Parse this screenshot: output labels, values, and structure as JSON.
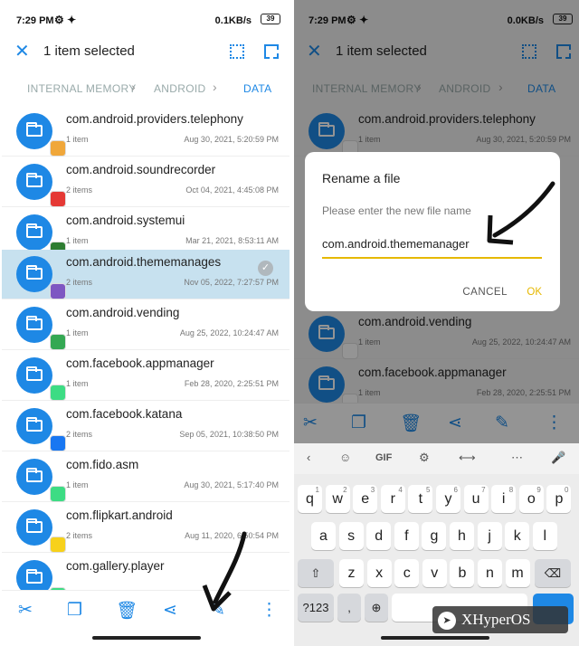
{
  "left": {
    "status": {
      "time": "7:29 PM",
      "net": "0.1KB/s",
      "battery": "39"
    },
    "header": {
      "title": "1 item selected"
    },
    "breadcrumb": [
      "INTERNAL MEMORY",
      "ANDROID",
      "DATA"
    ],
    "rows": [
      {
        "name": "com.android.providers.telephony",
        "count": "1 item",
        "date": "Aug 30, 2021, 5:20:59 PM",
        "badge": "#f0a73a"
      },
      {
        "name": "com.android.soundrecorder",
        "count": "2 items",
        "date": "Oct 04, 2021, 4:45:08 PM",
        "badge": "#e53935"
      },
      {
        "name": "com.android.systemui",
        "count": "1 item",
        "date": "Mar 21, 2021, 8:53:11 AM",
        "badge": "#2e7d32"
      },
      {
        "name": "com.android.thememanages",
        "count": "2 items",
        "date": "Nov 05, 2022, 7:27:57 PM",
        "badge": "#7e57c2"
      },
      {
        "name": "com.android.vending",
        "count": "1 item",
        "date": "Aug 25, 2022, 10:24:47 AM",
        "badge": "#34a853"
      },
      {
        "name": "com.facebook.appmanager",
        "count": "1 item",
        "date": "Feb 28, 2020, 2:25:51 PM",
        "badge": "#3ddc84"
      },
      {
        "name": "com.facebook.katana",
        "count": "2 items",
        "date": "Sep 05, 2021, 10:38:50 PM",
        "badge": "#1877f2"
      },
      {
        "name": "com.fido.asm",
        "count": "1 item",
        "date": "Aug 30, 2021, 5:17:40 PM",
        "badge": "#3ddc84"
      },
      {
        "name": "com.flipkart.android",
        "count": "2 items",
        "date": "Aug 11, 2020, 6:50:54 PM",
        "badge": "#f7d11b"
      },
      {
        "name": "com.gallery.player",
        "count": "",
        "date": "",
        "badge": "#3ddc84"
      }
    ],
    "selected_index": 3
  },
  "right": {
    "status": {
      "time": "7:29 PM",
      "net": "0.0KB/s",
      "battery": "39"
    },
    "header": {
      "title": "1 item selected"
    },
    "breadcrumb": [
      "INTERNAL MEMORY",
      "ANDROID",
      "DATA"
    ],
    "rows": [
      {
        "name": "com.android.providers.telephony",
        "count": "1 item",
        "date": "Aug 30, 2021, 5:20:59 PM"
      },
      {
        "name": "com.android.vending",
        "count": "1 item",
        "date": "Aug 25, 2022, 10:24:47 AM"
      },
      {
        "name": "com.facebook.appmanager",
        "count": "1 item",
        "date": "Feb 28, 2020, 2:25:51 PM"
      }
    ],
    "dialog": {
      "title": "Rename a file",
      "hint": "Please enter the new file name",
      "value": "com.android.thememanager",
      "cancel": "CANCEL",
      "ok": "OK"
    },
    "keyboard": {
      "suggest": [
        "GIF"
      ],
      "row1": [
        "q",
        "w",
        "e",
        "r",
        "t",
        "y",
        "u",
        "i",
        "o",
        "p"
      ],
      "row1_nums": [
        "1",
        "2",
        "3",
        "4",
        "5",
        "6",
        "7",
        "8",
        "9",
        "0"
      ],
      "row2": [
        "a",
        "s",
        "d",
        "f",
        "g",
        "h",
        "j",
        "k",
        "l"
      ],
      "row3": [
        "z",
        "x",
        "c",
        "v",
        "b",
        "n",
        "m"
      ],
      "sym": "?123",
      "comma": ","
    }
  },
  "watermark": "XHyperOS"
}
